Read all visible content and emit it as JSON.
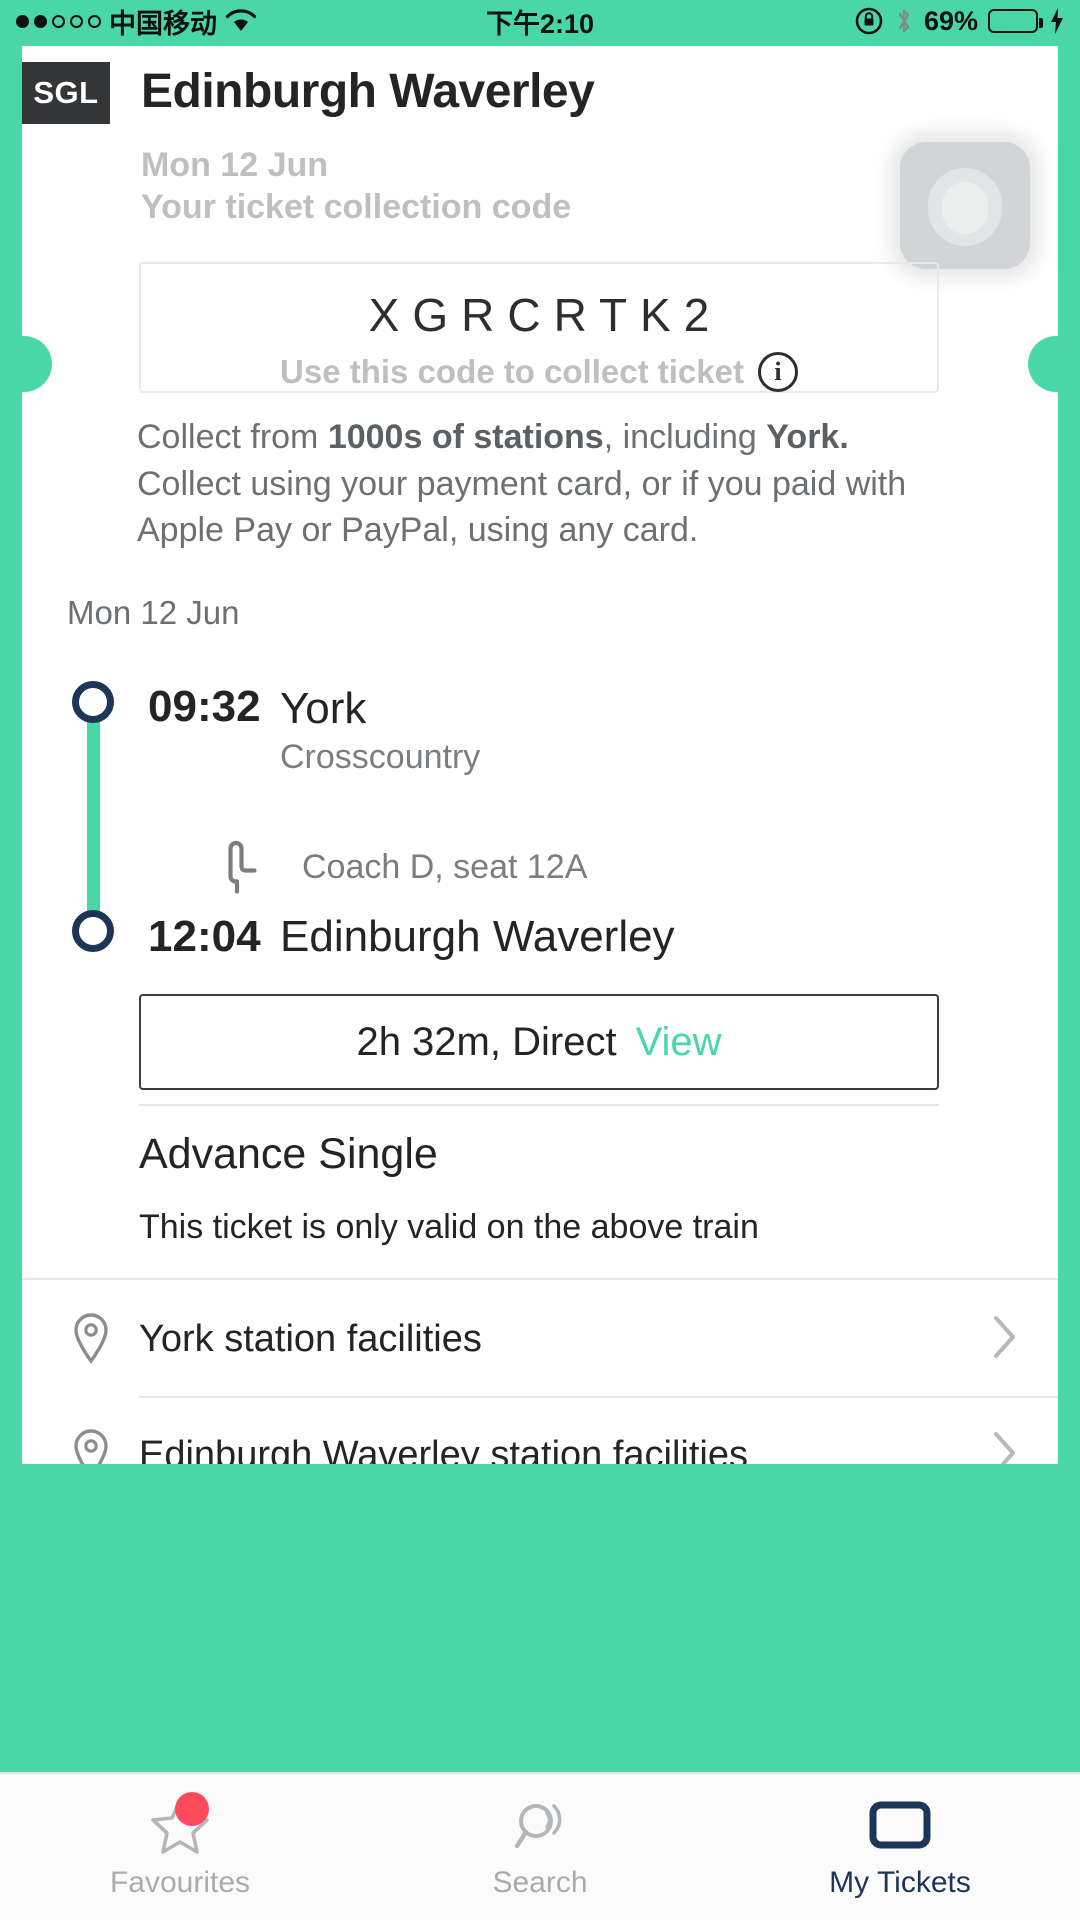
{
  "statusbar": {
    "carrier": "中国移动",
    "time": "下午2:10",
    "battery_pct": "69%",
    "signal_dots_filled": 2,
    "signal_dots_total": 5,
    "wifi_icon": "wifi-icon",
    "rotation_lock_icon": "rotation-lock-icon",
    "bluetooth_icon": "bluetooth-icon",
    "charging_icon": "charging-bolt-icon",
    "accent_green": "#5ef07e"
  },
  "header": {
    "badge": "SGL",
    "title": "Edinburgh Waverley",
    "date": "Mon 12 Jun",
    "subtitle": "Your ticket collection code"
  },
  "collection": {
    "code": "XGRCRTK2",
    "hint": "Use this code to collect ticket",
    "info_icon": "info-icon",
    "paragraph": {
      "part1": "Collect from ",
      "bold1": "1000s of stations",
      "part2": ", including ",
      "bold2": "York.",
      "part3": " Collect using your payment card, or if you paid with Apple Pay or PayPal, using any card."
    }
  },
  "journey": {
    "date": "Mon 12 Jun",
    "departure": {
      "time": "09:32",
      "station": "York",
      "operator": "Crosscountry"
    },
    "seat": {
      "icon": "seat-icon",
      "label": "Coach D, seat 12A"
    },
    "arrival": {
      "time": "12:04",
      "station": "Edinburgh Waverley"
    },
    "duration_button": {
      "duration": "2h 32m, Direct",
      "action": "View"
    },
    "line_color": "#4ad7a8",
    "stop_color": "#1d3557"
  },
  "fare": {
    "title": "Advance Single",
    "note": "This ticket is only valid on the above train"
  },
  "facilities": [
    {
      "label": "York station facilities",
      "icon": "map-pin-icon",
      "chevron": "chevron-right-icon"
    },
    {
      "label": "Edinburgh Waverley station facilities",
      "icon": "map-pin-icon",
      "chevron": "chevron-right-icon"
    }
  ],
  "tabbar": {
    "items": [
      {
        "label": "Favourites",
        "icon": "star-icon",
        "active": false,
        "badge": true
      },
      {
        "label": "Search",
        "icon": "search-signal-icon",
        "active": false,
        "badge": false
      },
      {
        "label": "My Tickets",
        "icon": "ticket-icon",
        "active": true,
        "badge": false
      }
    ],
    "active_color": "#1d3557",
    "inactive_color": "#a9acae",
    "badge_color": "#fb4a59"
  },
  "theme": {
    "brand_green": "#4ad7a8",
    "navy": "#1d3557",
    "dark": "#222426"
  }
}
